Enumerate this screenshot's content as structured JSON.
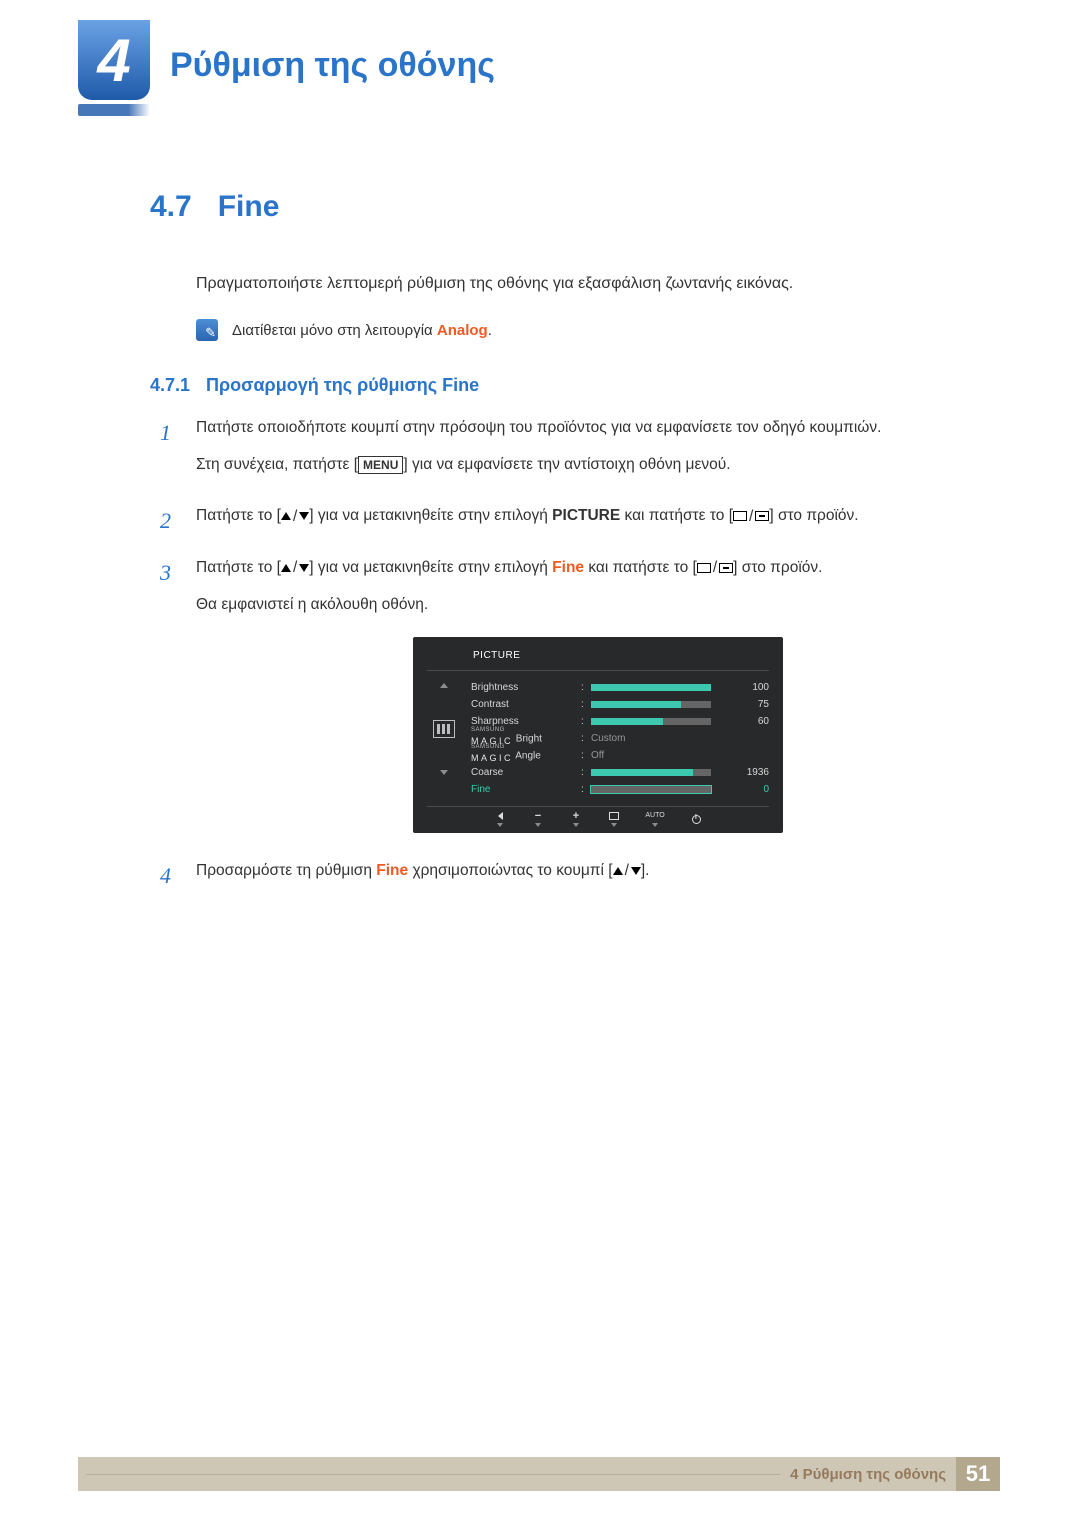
{
  "chapter": {
    "number": "4",
    "title": "Ρύθμιση της οθόνης"
  },
  "section": {
    "number": "4.7",
    "title": "Fine"
  },
  "lead": "Πραγματοποιήστε λεπτομερή ρύθμιση της οθόνης για εξασφάλιση ζωντανής εικόνας.",
  "note": {
    "prefix": "Διατίθεται μόνο στη λειτουργία ",
    "bold": "Analog",
    "suffix": "."
  },
  "subsection": {
    "number": "4.7.1",
    "title": "Προσαρμογή της ρύθμισης Fine"
  },
  "steps": {
    "s1": {
      "num": "1",
      "text": "Πατήστε οποιοδήποτε κουμπί στην πρόσοψη του προϊόντος για να εμφανίσετε τον οδηγό κουμπιών.",
      "sub_a": "Στη συνέχεια, πατήστε [",
      "menu": "MENU",
      "sub_b": "] για να εμφανίσετε την αντίστοιχη οθόνη μενού."
    },
    "s2": {
      "num": "2",
      "a": "Πατήστε το [",
      "b": "] για να μετακινηθείτε στην επιλογή ",
      "picture": "PICTURE",
      "c": " και πατήστε το [",
      "d": "] στο προϊόν."
    },
    "s3": {
      "num": "3",
      "a": "Πατήστε το [",
      "b": "] για να μετακινηθείτε στην επιλογή ",
      "fine": "Fine",
      "c": " και πατήστε το [",
      "d": "] στο προϊόν.",
      "after": "Θα εμφανιστεί η ακόλουθη οθόνη."
    },
    "s4": {
      "num": "4",
      "a": "Προσαρμόστε τη ρύθμιση ",
      "fine": "Fine",
      "b": " χρησιμοποιώντας το κουμπί [",
      "c": "]."
    }
  },
  "osd": {
    "title": "PICTURE",
    "rows": {
      "brightness": {
        "label": "Brightness",
        "value": "100",
        "pct": 100
      },
      "contrast": {
        "label": "Contrast",
        "value": "75",
        "pct": 75
      },
      "sharpness": {
        "label": "Sharpness",
        "value": "60",
        "pct": 60
      },
      "magicBright": {
        "sup": "SAMSUNG",
        "brand": "MAGIC",
        "tail": " Bright",
        "value": "Custom"
      },
      "magicAngle": {
        "sup": "SAMSUNG",
        "brand": "MAGIC",
        "tail": " Angle",
        "value": "Off"
      },
      "coarse": {
        "label": "Coarse",
        "value": "1936"
      },
      "fine": {
        "label": "Fine",
        "value": "0",
        "pct": 0
      }
    },
    "footer": {
      "auto": "AUTO"
    }
  },
  "footer": {
    "label": "4 Ρύθμιση της οθόνης",
    "page": "51"
  }
}
